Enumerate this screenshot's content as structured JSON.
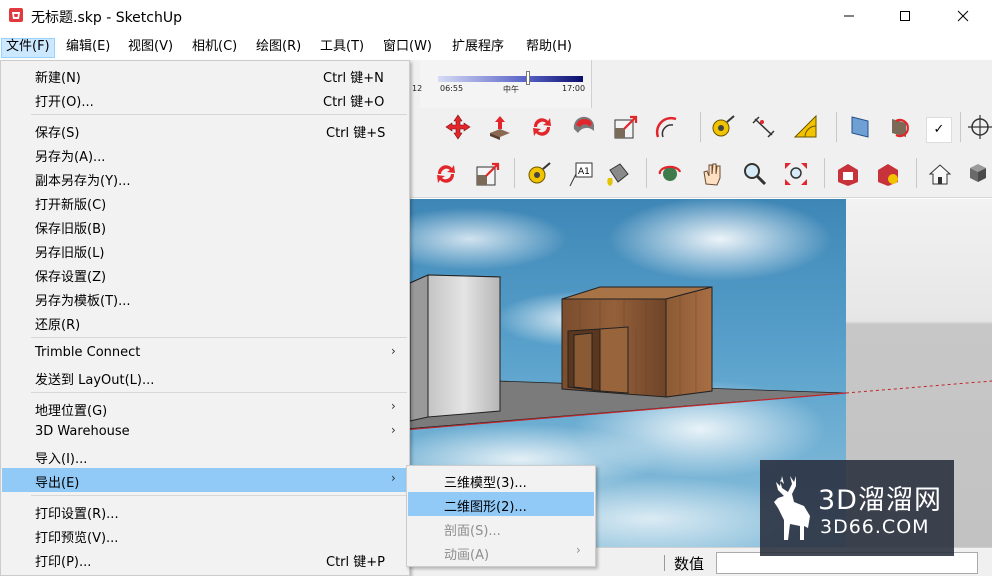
{
  "window": {
    "title": "无标题.skp - SketchUp",
    "icon": "sketchup-logo-icon"
  },
  "menubar": [
    {
      "label": "文件(F)",
      "active": true
    },
    {
      "label": "编辑(E)"
    },
    {
      "label": "视图(V)"
    },
    {
      "label": "相机(C)"
    },
    {
      "label": "绘图(R)"
    },
    {
      "label": "工具(T)"
    },
    {
      "label": "窗口(W)"
    },
    {
      "label": "扩展程序"
    },
    {
      "label": "帮助(H)"
    }
  ],
  "shadow_panel": {
    "left_label": "12",
    "start_label": "06:55",
    "mid_label": "中午",
    "end_label": "17:00",
    "slider_position": 0.62
  },
  "file_menu": {
    "items": [
      {
        "label": "新建(N)",
        "shortcut": "Ctrl 键+N"
      },
      {
        "label": "打开(O)...",
        "shortcut": "Ctrl 键+O"
      },
      {
        "label": "保存(S)",
        "shortcut": "Ctrl 键+S"
      },
      {
        "label": "另存为(A)..."
      },
      {
        "label": "副本另存为(Y)..."
      },
      {
        "label": "打开新版(C)"
      },
      {
        "label": "保存旧版(B)"
      },
      {
        "label": "另存旧版(L)"
      },
      {
        "label": "保存设置(Z)"
      },
      {
        "label": "另存为模板(T)..."
      },
      {
        "label": "还原(R)"
      },
      {
        "label": "Trimble Connect",
        "submenu": true
      },
      {
        "label": "发送到 LayOut(L)..."
      },
      {
        "label": "地理位置(G)",
        "submenu": true
      },
      {
        "label": "3D Warehouse",
        "submenu": true
      },
      {
        "label": "导入(I)..."
      },
      {
        "label": "导出(E)",
        "submenu": true,
        "highlighted": true
      },
      {
        "label": "打印设置(R)..."
      },
      {
        "label": "打印预览(V)..."
      },
      {
        "label": "打印(P)...",
        "shortcut": "Ctrl 键+P"
      }
    ]
  },
  "export_submenu": {
    "items": [
      {
        "label": "三维模型(3)..."
      },
      {
        "label": "二维图形(2)...",
        "highlighted": true
      },
      {
        "label": "剖面(S)...",
        "disabled": true
      },
      {
        "label": "动画(A)",
        "disabled": true,
        "submenu": true
      }
    ]
  },
  "statusbar": {
    "measurements_label": "数值",
    "measurements_value": ""
  },
  "watermark": {
    "title": "3D溜溜网",
    "subtitle": "3D66.COM"
  },
  "colors": {
    "menu_highlight": "#91c9f7",
    "menubar_active": "#cce8ff",
    "menu_bg": "#f2f2f2",
    "sky": "#5aa2cc",
    "wood": "#8a5a35",
    "ground": "#7b7b7b",
    "axis_red": "#c0282d"
  }
}
